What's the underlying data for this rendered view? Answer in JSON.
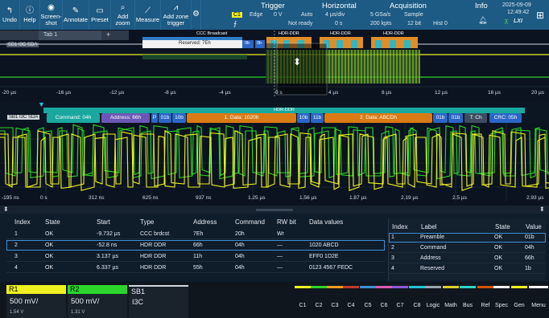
{
  "toolbar": {
    "buttons": [
      "Undo",
      "Help",
      "Screen-\nshot",
      "Annotate",
      "Preset",
      "Add\nzoom",
      "Measure",
      "Add zone\ntrigger"
    ],
    "trigger": {
      "title": "Trigger",
      "channel": "C1",
      "type": "Edge",
      "level": "0 V",
      "mode": "Auto",
      "status": "Not ready"
    },
    "horizontal": {
      "title": "Horizontal",
      "scale": "4 µs/div",
      "offset": "0 s"
    },
    "acquisition": {
      "title": "Acquisition",
      "rate": "5 GSa/s",
      "points": "200 kpts",
      "mode": "Sample",
      "bits": "12 bit",
      "hist": "Hist 0"
    },
    "info": {
      "title": "Info"
    },
    "date": "2025-09-09",
    "time": "12:49:42",
    "logo": "LXI"
  },
  "overview": {
    "tab": "Tab 1",
    "add_tab": "+",
    "bus_label": "SB1 I3C SDA",
    "segments": {
      "ccc_label": "CCC Broadcast",
      "reserved": "Reserved: 7Eh",
      "b0a": "0b",
      "b0b": "0b",
      "hdr1": "HDR-DDR",
      "hdr2": "HDR-DDR",
      "hdr3": "HDR-DDR"
    },
    "time_ticks": [
      "-20 µs",
      "-16 µs",
      "-12 µs",
      "-8 µs",
      "-4 µs",
      "0 s",
      "4 µs",
      "8 µs",
      "12 µs",
      "16 µs",
      "20 µs"
    ]
  },
  "zoom": {
    "bus_label": "SB1 I3C SDA",
    "hdr_title": "HDR-DDR",
    "segments": {
      "command": "Command: 04h",
      "address": "Address: 66h",
      "p": "P",
      "b01": "01b",
      "b10": "10b",
      "data1": "1. Data: 1020h",
      "b10b": "10b",
      "b11": "11b",
      "data2": "2. Data: ABCDh",
      "b01c": "01b",
      "b01d": "01b",
      "tch": "T: Ch",
      "crc": "CRC: 05h"
    },
    "time_ticks": [
      "-195 ns",
      "0 s",
      "312 ns",
      "625 ns",
      "937 ns",
      "1.25 µs",
      "1.56 µs",
      "1.87 µs",
      "2.19 µs",
      "2.5 µs",
      "2.93 µs"
    ]
  },
  "table1": {
    "headers": [
      "Index",
      "State",
      "Start",
      "Type",
      "Address",
      "Command",
      "RW bit",
      "Data values"
    ],
    "rows": [
      [
        "1",
        "OK",
        "-9.732 µs",
        "CCC brdcst",
        "7Eh",
        "20h",
        "Wr",
        ""
      ],
      [
        "2",
        "OK",
        "-52.8 ns",
        "HDR DDR",
        "66h",
        "04h",
        "—",
        "1020 ABCD"
      ],
      [
        "3",
        "OK",
        "3.137 µs",
        "HDR DDR",
        "11h",
        "04h",
        "—",
        "EFF0 1D2E"
      ],
      [
        "4",
        "OK",
        "6.337 µs",
        "HDR DDR",
        "55h",
        "04h",
        "—",
        "0123 4567 FEDC"
      ]
    ]
  },
  "table2": {
    "headers": [
      "Index",
      "Label",
      "State",
      "Value"
    ],
    "rows": [
      [
        "1",
        "Preamble",
        "OK",
        "01b"
      ],
      [
        "2",
        "Command",
        "OK",
        "04h"
      ],
      [
        "3",
        "Address",
        "OK",
        "66h"
      ],
      [
        "4",
        "Reserved",
        "OK",
        "1b"
      ]
    ]
  },
  "bottom": {
    "r1": {
      "name": "R1",
      "scale": "500 mV/",
      "offset": "1.54 V"
    },
    "r2": {
      "name": "R2",
      "scale": "500 mV/",
      "offset": "1.31 V"
    },
    "sb1": {
      "name": "SB1",
      "proto": "I3C"
    },
    "buttons": [
      "C1",
      "C2",
      "C3",
      "C4",
      "C5",
      "C6",
      "C7",
      "C8",
      "Logic",
      "Math",
      "Bus",
      "Ref",
      "Spec",
      "Gen",
      "Menu"
    ]
  },
  "colors": {
    "ch1": "#f0f020",
    "ch2": "#2bd62b",
    "accent": "#1d5a84",
    "cyan": "#22c3d6",
    "orange": "#d97a14",
    "purple": "#6b57b5",
    "teal": "#1aa7a0"
  }
}
